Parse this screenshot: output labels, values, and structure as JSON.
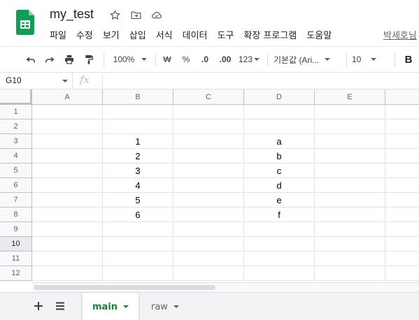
{
  "header": {
    "title": "my_test",
    "account_link": "박세호님",
    "menu": [
      "파일",
      "수정",
      "보기",
      "삽입",
      "서식",
      "데이터",
      "도구",
      "확장 프로그램",
      "도움말"
    ]
  },
  "toolbar": {
    "zoom": "100%",
    "currency": "₩",
    "percent": "%",
    "decimal_decrease": ".0",
    "decimal_increase": ".00",
    "number_format": "123",
    "font": "기본값 (Ari...",
    "font_size": "10",
    "bold": "B"
  },
  "formula_bar": {
    "name_box": "G10",
    "fx": "fx",
    "value": ""
  },
  "grid": {
    "columns": [
      "A",
      "B",
      "C",
      "D",
      "E"
    ],
    "rows": [
      "1",
      "2",
      "3",
      "4",
      "5",
      "6",
      "7",
      "8",
      "9",
      "10",
      "11",
      "12"
    ],
    "active_row": "10",
    "cells_b": [
      "",
      "",
      "1",
      "2",
      "3",
      "4",
      "5",
      "6",
      "",
      "",
      "",
      ""
    ],
    "cells_d": [
      "",
      "",
      "a",
      "b",
      "c",
      "d",
      "e",
      "f",
      "",
      "",
      "",
      ""
    ]
  },
  "sheets": {
    "tabs": [
      {
        "label": "main",
        "active": true
      },
      {
        "label": "raw",
        "active": false
      }
    ]
  },
  "colors": {
    "brand_green": "#0f9d58",
    "active_tab_text": "#188038"
  }
}
